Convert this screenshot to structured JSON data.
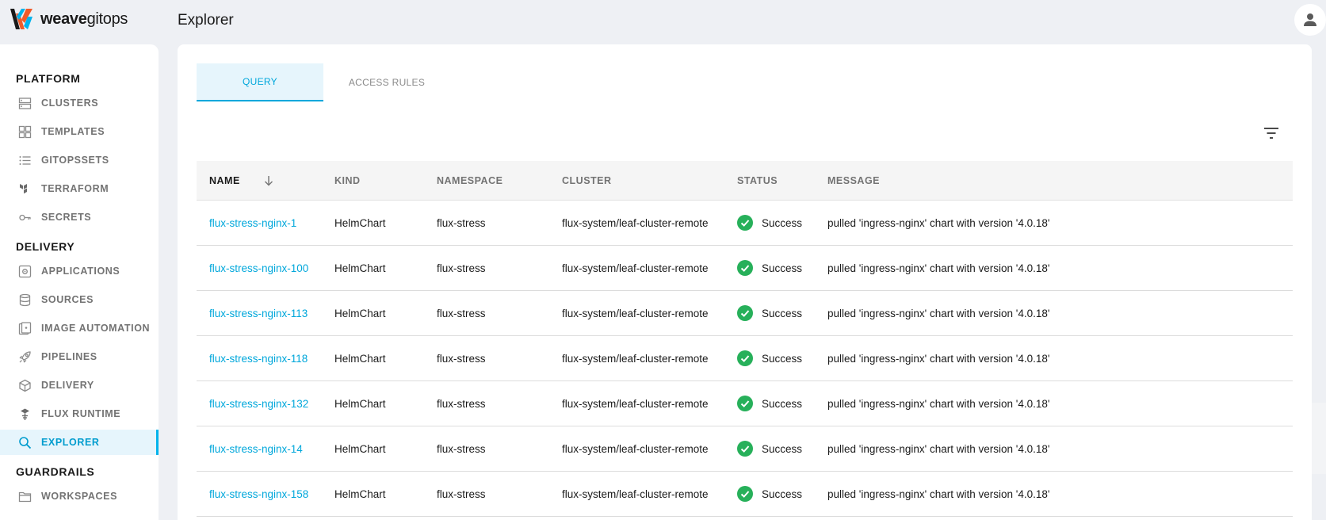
{
  "brand": {
    "name_bold": "weave",
    "name_rest": "gitops"
  },
  "header": {
    "title": "Explorer"
  },
  "sidebar": {
    "sections": [
      {
        "heading": "PLATFORM",
        "items": [
          {
            "label": "CLUSTERS",
            "icon": "clusters-icon"
          },
          {
            "label": "TEMPLATES",
            "icon": "templates-icon"
          },
          {
            "label": "GITOPSSETS",
            "icon": "gitopssets-icon"
          },
          {
            "label": "TERRAFORM",
            "icon": "terraform-icon"
          },
          {
            "label": "SECRETS",
            "icon": "key-icon"
          }
        ]
      },
      {
        "heading": "DELIVERY",
        "items": [
          {
            "label": "APPLICATIONS",
            "icon": "applications-icon"
          },
          {
            "label": "SOURCES",
            "icon": "database-icon"
          },
          {
            "label": "IMAGE AUTOMATION",
            "icon": "image-automation-icon"
          },
          {
            "label": "PIPELINES",
            "icon": "rocket-icon"
          },
          {
            "label": "DELIVERY",
            "icon": "cube-icon"
          },
          {
            "label": "FLUX RUNTIME",
            "icon": "flux-icon"
          },
          {
            "label": "EXPLORER",
            "icon": "search-icon",
            "active": true
          }
        ]
      },
      {
        "heading": "GUARDRAILS",
        "items": [
          {
            "label": "WORKSPACES",
            "icon": "folder-icon"
          }
        ]
      }
    ]
  },
  "tabs": [
    {
      "label": "QUERY",
      "active": true
    },
    {
      "label": "ACCESS RULES",
      "active": false
    }
  ],
  "table": {
    "columns": [
      "NAME",
      "KIND",
      "NAMESPACE",
      "CLUSTER",
      "STATUS",
      "MESSAGE"
    ],
    "sort": {
      "column": "NAME",
      "direction": "descending-arrow"
    },
    "rows": [
      {
        "name": "flux-stress-nginx-1",
        "kind": "HelmChart",
        "namespace": "flux-stress",
        "cluster": "flux-system/leaf-cluster-remote",
        "status": "Success",
        "message": "pulled 'ingress-nginx' chart with version '4.0.18'"
      },
      {
        "name": "flux-stress-nginx-100",
        "kind": "HelmChart",
        "namespace": "flux-stress",
        "cluster": "flux-system/leaf-cluster-remote",
        "status": "Success",
        "message": "pulled 'ingress-nginx' chart with version '4.0.18'"
      },
      {
        "name": "flux-stress-nginx-113",
        "kind": "HelmChart",
        "namespace": "flux-stress",
        "cluster": "flux-system/leaf-cluster-remote",
        "status": "Success",
        "message": "pulled 'ingress-nginx' chart with version '4.0.18'"
      },
      {
        "name": "flux-stress-nginx-118",
        "kind": "HelmChart",
        "namespace": "flux-stress",
        "cluster": "flux-system/leaf-cluster-remote",
        "status": "Success",
        "message": "pulled 'ingress-nginx' chart with version '4.0.18'"
      },
      {
        "name": "flux-stress-nginx-132",
        "kind": "HelmChart",
        "namespace": "flux-stress",
        "cluster": "flux-system/leaf-cluster-remote",
        "status": "Success",
        "message": "pulled 'ingress-nginx' chart with version '4.0.18'"
      },
      {
        "name": "flux-stress-nginx-14",
        "kind": "HelmChart",
        "namespace": "flux-stress",
        "cluster": "flux-system/leaf-cluster-remote",
        "status": "Success",
        "message": "pulled 'ingress-nginx' chart with version '4.0.18'"
      },
      {
        "name": "flux-stress-nginx-158",
        "kind": "HelmChart",
        "namespace": "flux-stress",
        "cluster": "flux-system/leaf-cluster-remote",
        "status": "Success",
        "message": "pulled 'ingress-nginx' chart with version '4.0.18'"
      }
    ]
  },
  "colors": {
    "accent": "#00a7db",
    "success": "#27b05a",
    "brand_orange": "#f15a29",
    "brand_blue": "#00b3ec"
  }
}
